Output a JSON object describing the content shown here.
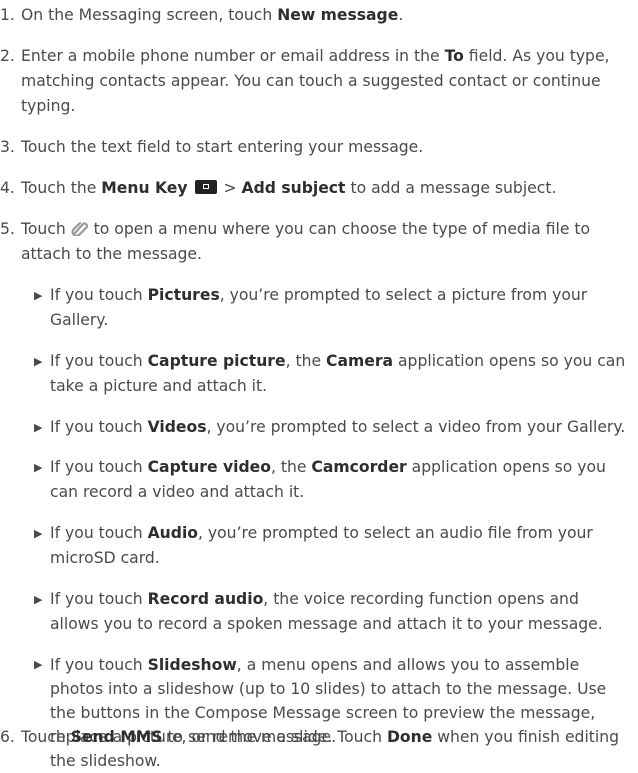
{
  "steps": [
    {
      "num": "1.",
      "a": "On the Messaging screen, touch ",
      "b": "New message",
      "c": "."
    },
    {
      "num": "2.",
      "a": "Enter a mobile phone number or email address in the ",
      "b": "To",
      "c": " field. As you type, matching contacts appear. You can touch a suggested contact or continue typing."
    },
    {
      "num": "3.",
      "text": "Touch the text field to start entering your message."
    },
    {
      "num": "4.",
      "a": "Touch the ",
      "b": "Menu Key",
      "c": " > ",
      "d": "Add subject",
      "e": " to add a message subject."
    },
    {
      "num": "5.",
      "a": "Touch ",
      "b": " to open a menu where you can choose the type of media file to attach to the message."
    },
    {
      "num": "6.",
      "a": "Touch ",
      "b": "Send MMS",
      "c": " to send the message."
    }
  ],
  "bullets": [
    {
      "a": "If you touch ",
      "b": "Pictures",
      "c": ", you’re prompted to select a picture from your Gallery."
    },
    {
      "a": "If you touch ",
      "b": "Capture picture",
      "c": ", the ",
      "d": "Camera",
      "e": " application opens so you can take a picture and attach it."
    },
    {
      "a": "If you touch ",
      "b": "Videos",
      "c": ", you’re prompted to select a video from your Gallery."
    },
    {
      "a": "If you touch ",
      "b": "Capture video",
      "c": ", the ",
      "d": "Camcorder",
      "e": " application opens so you can record a video and attach it."
    },
    {
      "a": "If you touch ",
      "b": "Audio",
      "c": ", you’re prompted to select an audio file from your microSD card."
    },
    {
      "a": "If you touch ",
      "b": "Record audio",
      "c": ", the voice recording function opens and allows you to record a spoken message and attach it to your message."
    },
    {
      "a": "If you touch ",
      "b": "Slideshow",
      "c": ", a menu opens and allows you to assemble photos into a slideshow (up to 10 slides) to attach to the message. Use the buttons in the Compose Message screen to preview the message, replace a picture, or remove a slide. Touch ",
      "d": "Done",
      "e": " when you finish editing the slideshow."
    }
  ],
  "bullet_marker": "▶"
}
